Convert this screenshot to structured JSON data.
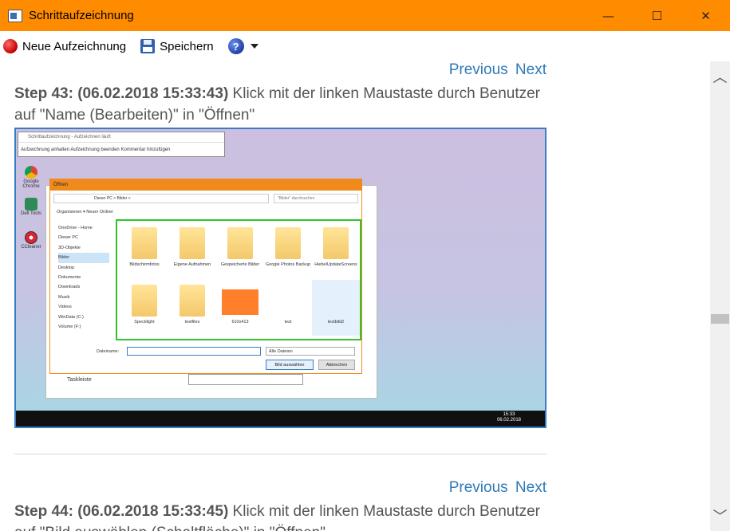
{
  "window": {
    "title": "Schrittaufzeichnung",
    "minimize_glyph": "—",
    "maximize_glyph": "☐",
    "close_glyph": "✕"
  },
  "toolbar": {
    "new_recording_label": "Neue Aufzeichnung",
    "save_label": "Speichern",
    "help_glyph": "?"
  },
  "steps": [
    {
      "nav_previous": "Previous",
      "nav_next": "Next",
      "heading": "Step 43: (06.02.2018 15:33:43)",
      "description": " Klick mit der linken Maustaste durch Benutzer auf \"Name (Bearbeiten)\" in \"Öffnen\""
    },
    {
      "nav_previous": "Previous",
      "nav_next": "Next",
      "heading": "Step 44: (06.02.2018 15:33:45)",
      "description": " Klick mit der linken Maustaste durch Benutzer auf \"Bild auswählen (Schaltfläche)\" in \"Öffnen\""
    }
  ],
  "screenshot": {
    "psr_title": "Schrittaufzeichnung - Aufzeichnen läuft",
    "psr_toolbar": "Aufzeichnung anhalten   Aufzeichnung beenden   Kommentar hinzufügen",
    "desktop_icons": [
      "Google Chrome",
      "Dell Tools",
      "CCleaner"
    ],
    "dialog_title": "Öffnen",
    "address_path": "Dieser PC  >  Bilder  >",
    "search_placeholder": "\"Bilder\" durchsuchen",
    "organize_label": "Organisieren ▾      Neuer Ordner",
    "tree_items": [
      "OneDrive - Home",
      "Dieser PC",
      "3D-Objekte",
      "Bilder",
      "Desktop",
      "Dokumente",
      "Downloads",
      "Musik",
      "Videos",
      "WinData (C:)",
      "Volume (F:)"
    ],
    "files": [
      "Bildschirmfotos",
      "Eigene Aufnahmen",
      "Gespeicherte Bilder",
      "Google Photos Backup",
      "HiebelUpdateScreens",
      "Spectilight",
      "testfiles",
      "610x413",
      "test",
      "testbild2"
    ],
    "filename_label": "Dateiname:",
    "filetype_value": "Alle Dateien",
    "select_button": "Bild auswählen",
    "cancel_button": "Abbrechen",
    "behind_label": "Taskleiste",
    "clock_time": "15:33",
    "clock_date": "06.02.2018"
  },
  "colors": {
    "titlebar": "#ff8c00",
    "link": "#2f7ab8",
    "screenshot_border": "#3a7cc7",
    "highlight": "#2ec42e"
  }
}
